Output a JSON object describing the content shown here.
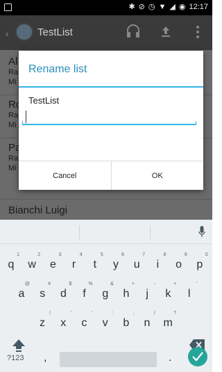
{
  "status_bar": {
    "time": "12:17"
  },
  "action_bar": {
    "title": "TestList"
  },
  "list": {
    "items": [
      {
        "name": "Al",
        "sub1": "Ra",
        "sub2": "Mi"
      },
      {
        "name": "Ro",
        "sub1": "Ra",
        "sub2": "Mi"
      },
      {
        "name": "Pa",
        "sub1": "Ra",
        "sub2": "Mi"
      },
      {
        "name": "Bianchi Luigi"
      }
    ]
  },
  "dialog": {
    "title": "Rename list",
    "message": "TestList",
    "input_value": "",
    "cancel_label": "Cancel",
    "ok_label": "OK"
  },
  "keyboard": {
    "row1": [
      {
        "key": "q",
        "hint": "1"
      },
      {
        "key": "w",
        "hint": "2"
      },
      {
        "key": "e",
        "hint": "3"
      },
      {
        "key": "r",
        "hint": "4"
      },
      {
        "key": "t",
        "hint": "5"
      },
      {
        "key": "y",
        "hint": "6"
      },
      {
        "key": "u",
        "hint": "7"
      },
      {
        "key": "i",
        "hint": "8"
      },
      {
        "key": "o",
        "hint": "9"
      },
      {
        "key": "p",
        "hint": "0"
      }
    ],
    "row2": [
      {
        "key": "a",
        "hint": "@"
      },
      {
        "key": "s",
        "hint": "#"
      },
      {
        "key": "d",
        "hint": "$"
      },
      {
        "key": "f",
        "hint": "%"
      },
      {
        "key": "g",
        "hint": "&"
      },
      {
        "key": "h",
        "hint": "+"
      },
      {
        "key": "j",
        "hint": "-"
      },
      {
        "key": "k",
        "hint": "+"
      },
      {
        "key": "l",
        "hint": "'"
      }
    ],
    "row3": [
      {
        "key": "z",
        "hint": "!"
      },
      {
        "key": "x",
        "hint": "'"
      },
      {
        "key": "c",
        "hint": "'"
      },
      {
        "key": "v",
        "hint": ":"
      },
      {
        "key": "b",
        "hint": ";"
      },
      {
        "key": "n",
        "hint": "/"
      },
      {
        "key": "m",
        "hint": "?"
      }
    ],
    "symbols_label": "?123",
    "comma_label": ",",
    "period_label": ".",
    "accent_color": "#26a69a"
  }
}
